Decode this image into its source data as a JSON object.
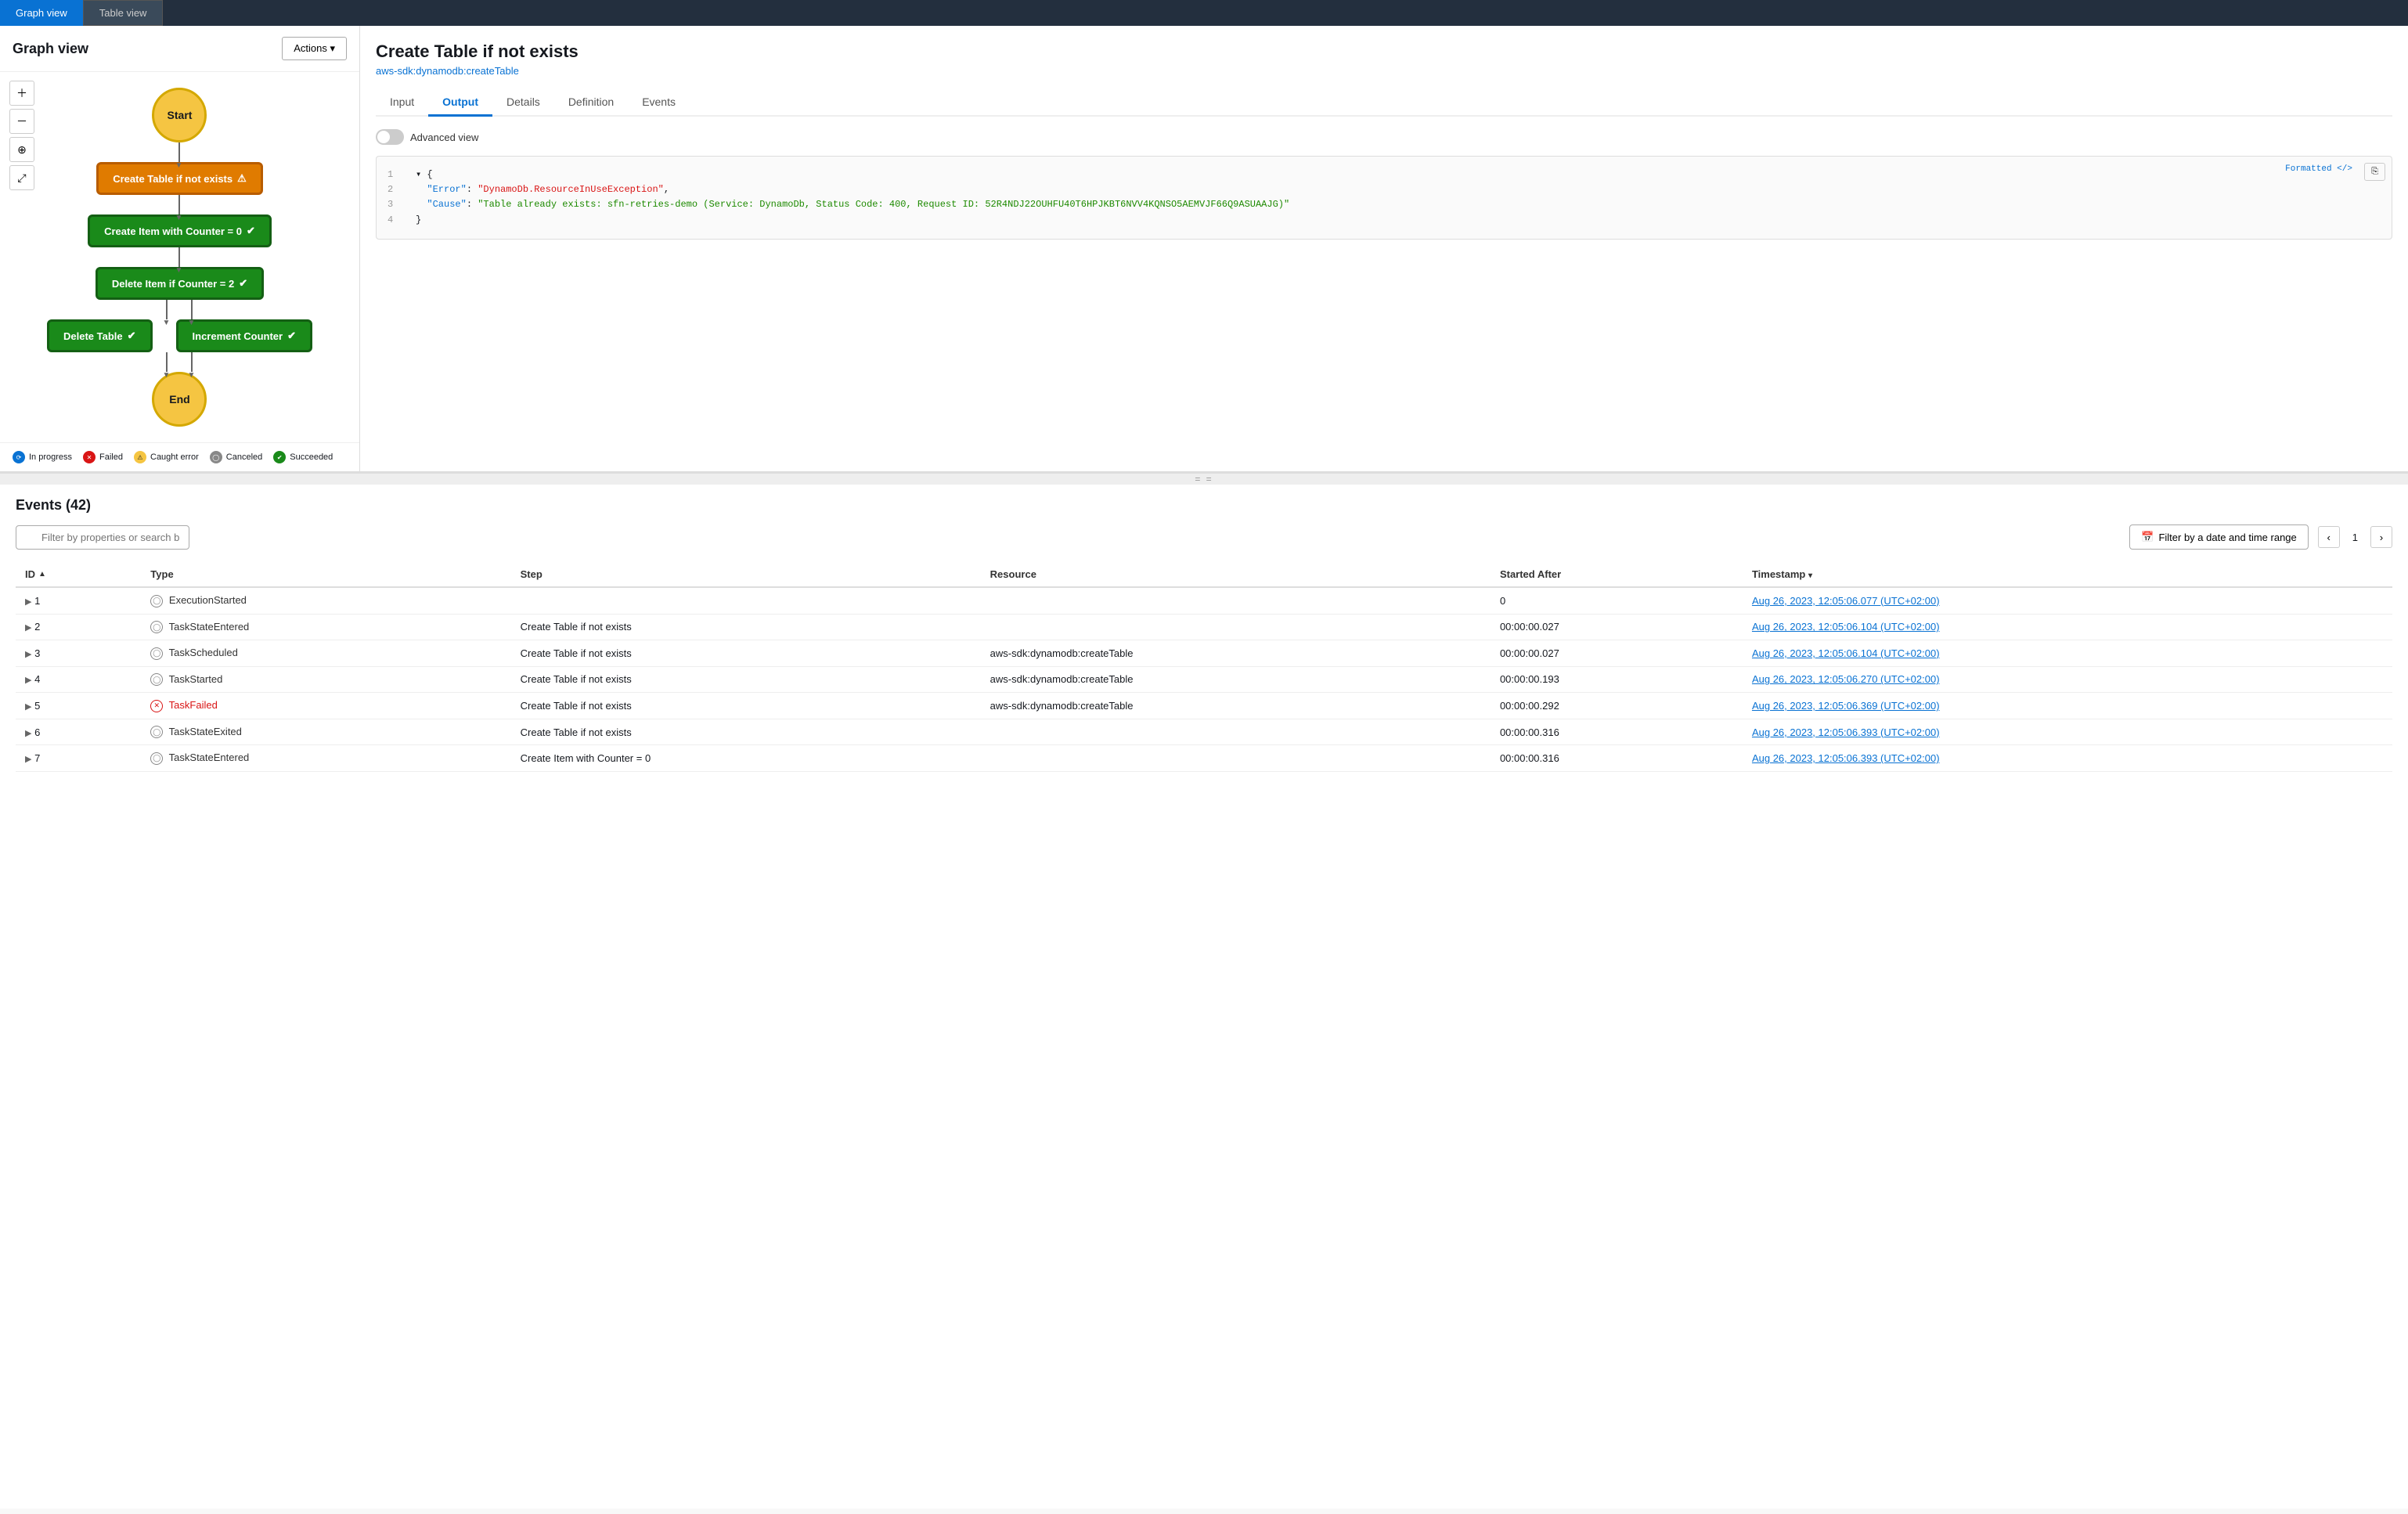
{
  "topTabs": [
    {
      "id": "graph",
      "label": "Graph view",
      "active": true
    },
    {
      "id": "table",
      "label": "Table view",
      "active": false
    }
  ],
  "graphPanel": {
    "title": "Graph view",
    "actionsBtn": "Actions ▾",
    "nodes": {
      "start": "Start",
      "end": "End",
      "createTable": "Create Table if not exists",
      "createItem": "Create Item with Counter = 0",
      "deleteItem": "Delete Item if Counter = 2",
      "deleteTable": "Delete Table",
      "incrementCounter": "Increment Counter"
    },
    "legend": [
      {
        "id": "in-progress",
        "label": "In progress",
        "type": "in-progress"
      },
      {
        "id": "failed",
        "label": "Failed",
        "type": "failed"
      },
      {
        "id": "caught",
        "label": "Caught error",
        "type": "caught"
      },
      {
        "id": "canceled",
        "label": "Canceled",
        "type": "canceled"
      },
      {
        "id": "succeeded",
        "label": "Succeeded",
        "type": "succeeded"
      }
    ]
  },
  "detailPanel": {
    "title": "Create Table if not exists",
    "subtitle": "aws-sdk:dynamodb:createTable",
    "tabs": [
      "Input",
      "Output",
      "Details",
      "Definition",
      "Events"
    ],
    "activeTab": "Output",
    "advancedViewLabel": "Advanced view",
    "codeLines": [
      {
        "num": 1,
        "content": "{",
        "type": "plain"
      },
      {
        "num": 2,
        "key": "\"Error\"",
        "value": "\"DynamoDb.ResourceInUseException\",",
        "type": "keyval",
        "valueColor": "red"
      },
      {
        "num": 3,
        "key": "\"Cause\"",
        "value": "\"Table already exists: sfn-retries-demo (Service: DynamoDb, Status Code: 400, Request ID: 52R4NDJ22OUHFU40T6HPJKBT6NVV4KQNSO5AEMVJF66Q9ASUAAJG)\"",
        "type": "keyval",
        "valueColor": "green"
      },
      {
        "num": 4,
        "content": "}",
        "type": "plain"
      }
    ],
    "copyBtn": "⎘",
    "formattedLabel": "Formatted </>"
  },
  "eventsSection": {
    "title": "Events (42)",
    "searchPlaceholder": "Filter by properties or search by keyword",
    "dateFilterLabel": "Filter by a date and time range",
    "pagination": {
      "current": 1,
      "prev": "‹",
      "next": "›"
    },
    "tableColumns": [
      "ID",
      "Type",
      "Step",
      "Resource",
      "Started After",
      "Timestamp"
    ],
    "rows": [
      {
        "id": 1,
        "type": "ExecutionStarted",
        "typeFailed": false,
        "step": "",
        "resource": "",
        "startedAfter": "0",
        "timestamp": "Aug 26, 2023, 12:05:06.077 (UTC+02:00)"
      },
      {
        "id": 2,
        "type": "TaskStateEntered",
        "typeFailed": false,
        "step": "Create Table if not exists",
        "resource": "",
        "startedAfter": "00:00:00.027",
        "timestamp": "Aug 26, 2023, 12:05:06.104 (UTC+02:00)"
      },
      {
        "id": 3,
        "type": "TaskScheduled",
        "typeFailed": false,
        "step": "Create Table if not exists",
        "resource": "aws-sdk:dynamodb:createTable",
        "startedAfter": "00:00:00.027",
        "timestamp": "Aug 26, 2023, 12:05:06.104 (UTC+02:00)"
      },
      {
        "id": 4,
        "type": "TaskStarted",
        "typeFailed": false,
        "step": "Create Table if not exists",
        "resource": "aws-sdk:dynamodb:createTable",
        "startedAfter": "00:00:00.193",
        "timestamp": "Aug 26, 2023, 12:05:06.270 (UTC+02:00)"
      },
      {
        "id": 5,
        "type": "TaskFailed",
        "typeFailed": true,
        "step": "Create Table if not exists",
        "resource": "aws-sdk:dynamodb:createTable",
        "startedAfter": "00:00:00.292",
        "timestamp": "Aug 26, 2023, 12:05:06.369 (UTC+02:00)"
      },
      {
        "id": 6,
        "type": "TaskStateExited",
        "typeFailed": false,
        "step": "Create Table if not exists",
        "resource": "",
        "startedAfter": "00:00:00.316",
        "timestamp": "Aug 26, 2023, 12:05:06.393 (UTC+02:00)"
      },
      {
        "id": 7,
        "type": "TaskStateEntered",
        "typeFailed": false,
        "step": "Create Item with Counter = 0",
        "resource": "",
        "startedAfter": "00:00:00.316",
        "timestamp": "Aug 26, 2023, 12:05:06.393 (UTC+02:00)"
      }
    ]
  }
}
